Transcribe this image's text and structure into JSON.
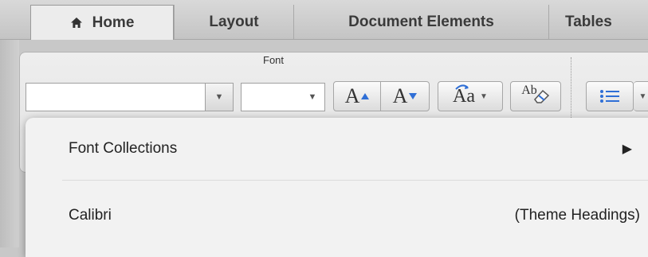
{
  "tabs": [
    {
      "label": "Home",
      "icon": "home-icon",
      "active": true
    },
    {
      "label": "Layout"
    },
    {
      "label": "Document Elements"
    },
    {
      "label": "Tables"
    }
  ],
  "ribbon": {
    "font_group_title": "Font",
    "font_name_value": "",
    "font_size_value": "",
    "grow_font_label": "A",
    "shrink_font_label": "A",
    "change_case_label": "Aa",
    "clear_format_label": "Ab"
  },
  "menu": {
    "font_collections_label": "Font Collections",
    "font_collections_arrow": "▶",
    "calibri_label": "Calibri",
    "calibri_note": "(Theme Headings)"
  },
  "colors": {
    "tab_bg": "#c4c4c4",
    "active_tab_bg": "#ececec",
    "ribbon_bg": "#e8e8e8",
    "menu_bg": "#f2f2f2",
    "accent_blue": "#2f6fd6"
  }
}
